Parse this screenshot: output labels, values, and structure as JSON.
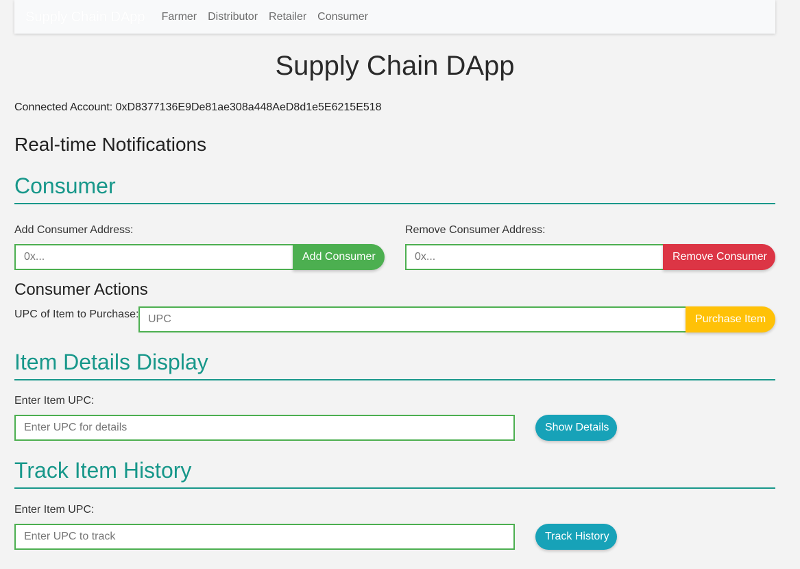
{
  "navbar": {
    "brand": "Supply Chain DApp",
    "links": [
      "Farmer",
      "Distributor",
      "Retailer",
      "Consumer"
    ]
  },
  "page": {
    "title": "Supply Chain DApp",
    "account_text": "Connected Account: 0xD8377136E9De81ae308a448AeD8d1e5E6215E518",
    "notifications_title": "Real-time Notifications"
  },
  "consumer": {
    "section_title": "Consumer",
    "add_label": "Add Consumer Address:",
    "add_placeholder": "0x...",
    "add_button": "Add Consumer",
    "remove_label": "Remove Consumer Address:",
    "remove_placeholder": "0x...",
    "remove_button": "Remove Consumer",
    "actions_title": "Consumer Actions",
    "upc_label": "UPC of Item to Purchase:",
    "upc_placeholder": "UPC",
    "purchase_button": "Purchase Item"
  },
  "item_details": {
    "section_title": "Item Details Display",
    "label": "Enter Item UPC:",
    "placeholder": "Enter UPC for details",
    "button": "Show Details"
  },
  "track_history": {
    "section_title": "Track Item History",
    "label": "Enter Item UPC:",
    "placeholder": "Enter UPC to track",
    "button": "Track History"
  },
  "colors": {
    "accent": "#17978a",
    "success": "#4caf50",
    "danger": "#dc3545",
    "warning": "#ffc107",
    "info": "#17a2b8",
    "background": "#f3f3f3"
  }
}
